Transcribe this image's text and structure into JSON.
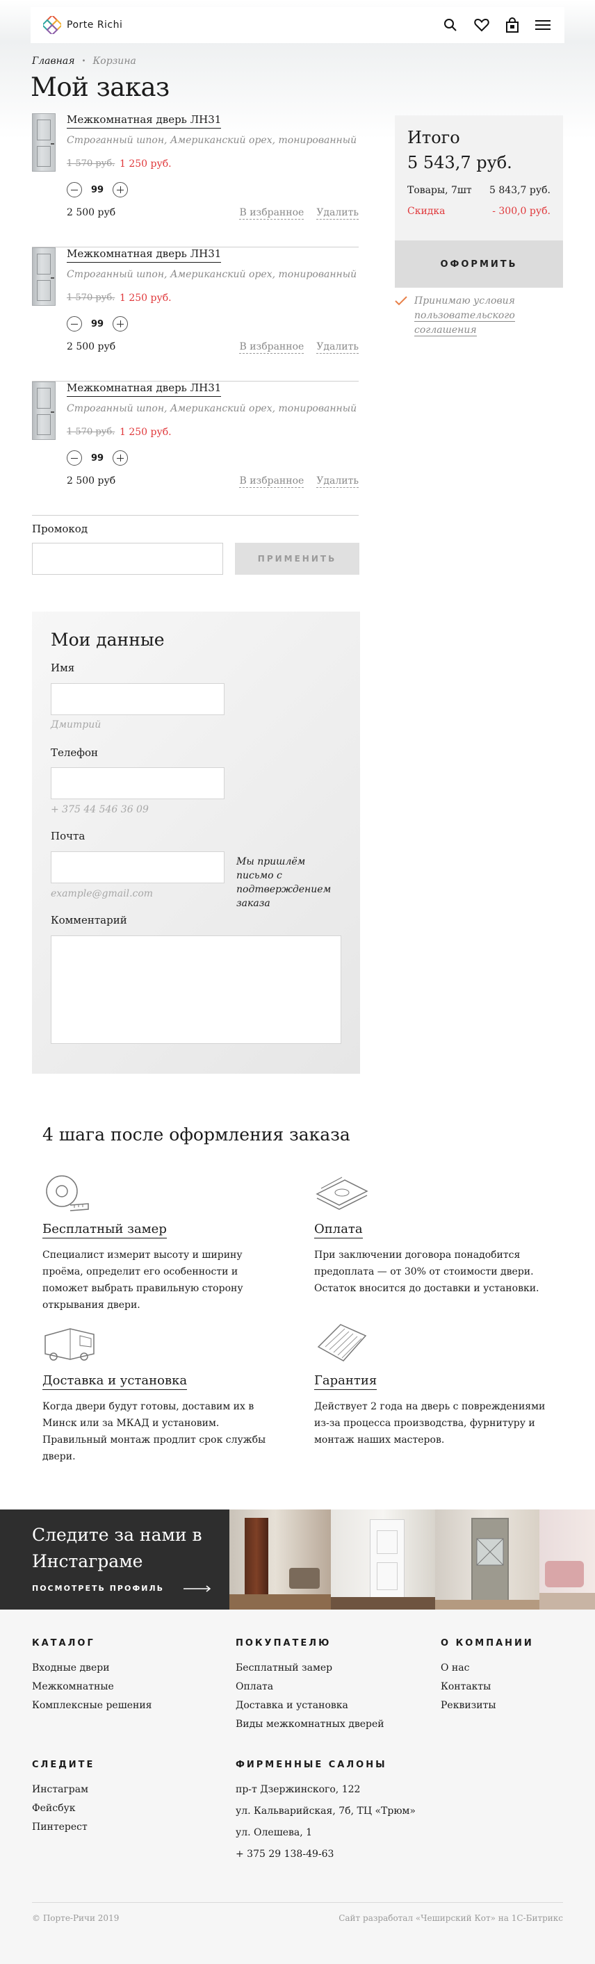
{
  "header": {
    "logo_text": "Porte Richi",
    "icons": [
      "search-icon",
      "heart-icon",
      "bag-icon",
      "menu-icon"
    ]
  },
  "breadcrumb": {
    "home": "Главная",
    "current": "Корзина"
  },
  "page_title": "Мой заказ",
  "cart": {
    "items": [
      {
        "name": "Межкомнатная дверь ЛН31",
        "desc": "Строганный шпон, Американский орех, тонированный",
        "old_price": "1 570 руб.",
        "price": "1 250 руб.",
        "qty": "99",
        "sum": "2 500 руб",
        "fav": "В избранное",
        "remove": "Удалить"
      },
      {
        "name": "Межкомнатная дверь ЛН31",
        "desc": "Строганный шпон, Американский орех, тонированный",
        "old_price": "1 570 руб.",
        "price": "1 250 руб.",
        "qty": "99",
        "sum": "2 500 руб",
        "fav": "В избранное",
        "remove": "Удалить"
      },
      {
        "name": "Межкомнатная дверь ЛН31",
        "desc": "Строганный шпон, Американский орех, тонированный",
        "old_price": "1 570 руб.",
        "price": "1 250 руб.",
        "qty": "99",
        "sum": "2 500 руб",
        "fav": "В избранное",
        "remove": "Удалить"
      }
    ]
  },
  "summary": {
    "title": "Итого",
    "total": "5 543,7 руб.",
    "goods_label": "Товары, 7шт",
    "goods_value": "5 843,7 руб.",
    "discount_label": "Скидка",
    "discount_value": "- 300,0 руб.",
    "checkout": "ОФОРМИТЬ",
    "agree_text": "Принимаю условия",
    "agree_link": "пользовательского соглашения"
  },
  "promo": {
    "label": "Промокод",
    "button": "ПРИМЕНИТЬ"
  },
  "form": {
    "title": "Мои данные",
    "name_label": "Имя",
    "name_hint": "Дмитрий",
    "phone_label": "Телефон",
    "phone_hint": "+ 375 44 546 36 09",
    "email_label": "Почта",
    "email_hint": "example@gmail.com",
    "email_note": "Мы пришлём письмо с подтверждением заказа",
    "comment_label": "Комментарий"
  },
  "steps": {
    "title": "4 шага после оформления заказа",
    "items": [
      {
        "title": "Бесплатный замер",
        "text": "Специалист измерит высоту и ширину проёма, определит его особенности и поможет выбрать правильную сторону открывания двери.",
        "icon": "tape-measure-icon"
      },
      {
        "title": "Оплата",
        "text": "При заключении договора понадобится предоплата — от 30% от стоимости двери. Остаток вносится до доставки и установки.",
        "icon": "money-icon"
      },
      {
        "title": "Доставка и установка",
        "text": "Когда двери будут готовы, доставим их в Минск или за МКАД и установим. Правильный монтаж продлит срок службы двери.",
        "icon": "truck-icon"
      },
      {
        "title": "Гарантия",
        "text": "Действует 2 года на дверь с повреждениями из-за процесса производства, фурнитуру и монтаж наших мастеров.",
        "icon": "warranty-icon"
      }
    ]
  },
  "instagram": {
    "title": "Следите за нами в Инстаграме",
    "link": "ПОСМОТРЕТЬ ПРОФИЛЬ"
  },
  "footer": {
    "catalog": {
      "title": "КАТАЛОГ",
      "links": [
        "Входные двери",
        "Межкомнатные",
        "Комплексные решения"
      ]
    },
    "buyer": {
      "title": "ПОКУПАТЕЛЮ",
      "links": [
        "Бесплатный замер",
        "Оплата",
        "Доставка и установка",
        "Виды межкомнатных дверей"
      ]
    },
    "company": {
      "title": "О КОМПАНИИ",
      "links": [
        "О нас",
        "Контакты",
        "Реквизиты"
      ]
    },
    "follow": {
      "title": "СЛЕДИТЕ",
      "links": [
        "Инстаграм",
        "Фейсбук",
        "Пинтерест"
      ]
    },
    "salons": {
      "title": "ФИРМЕННЫЕ САЛОНЫ",
      "links": [
        "пр-т Дзержинского, 122",
        "ул. Кальварийская, 7б, ТЦ «Трюм»",
        "ул. Олешева, 1",
        "+ 375 29 138-49-63"
      ]
    },
    "copyright": "© Порте-Ричи 2019",
    "developer": "Сайт разработал «Чеширский Кот» на 1С-Битрикс"
  },
  "colors": {
    "accent_red": "#e0383b",
    "dark": "#2e2e2e",
    "check_orange": "#e8814a"
  }
}
